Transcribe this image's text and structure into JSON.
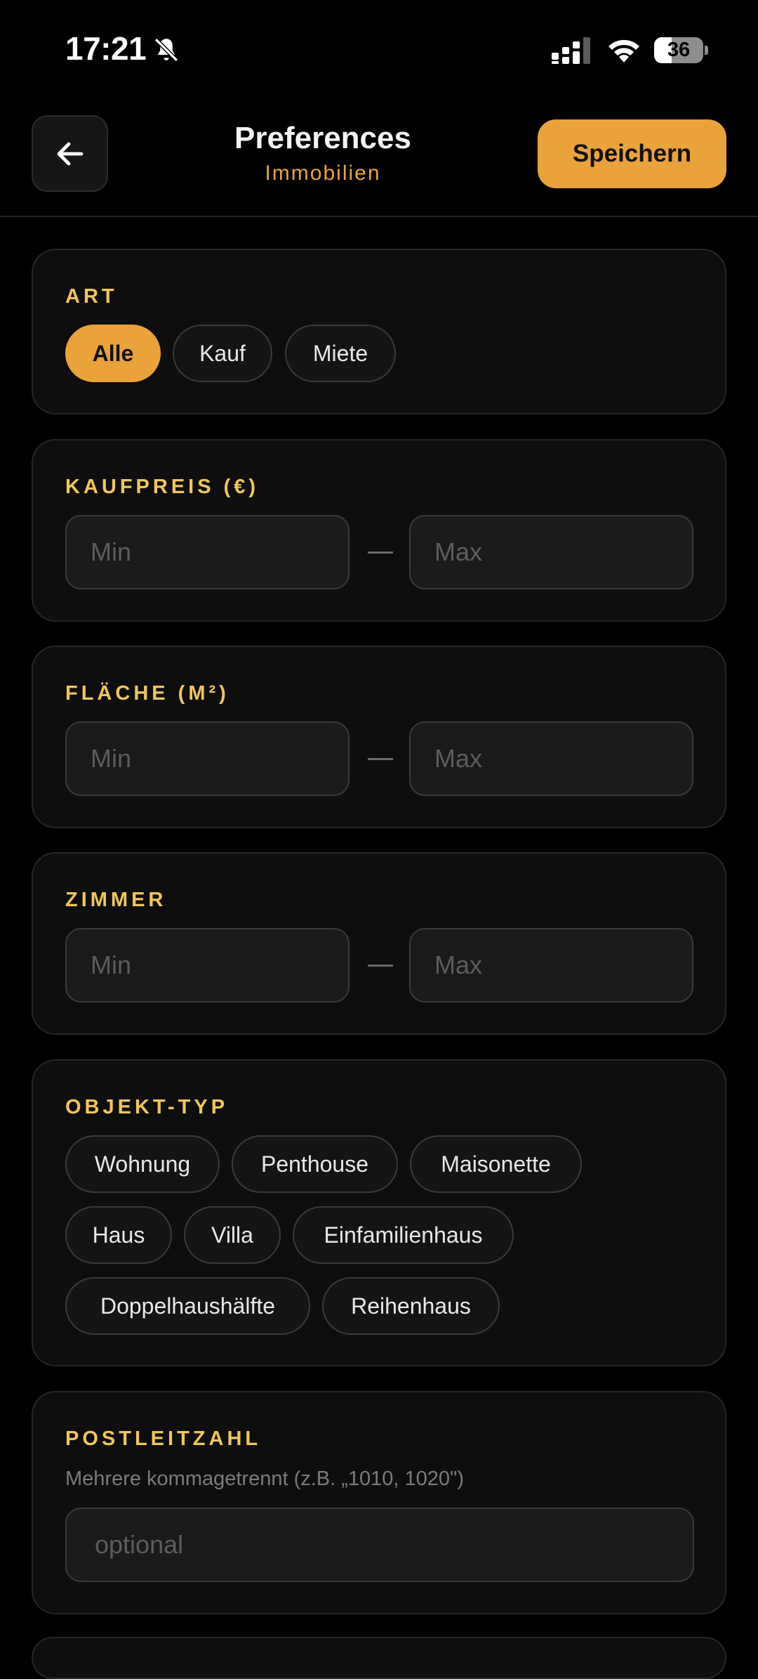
{
  "status_bar": {
    "time": "17:21",
    "battery_level": "36",
    "battery_fraction": 0.36
  },
  "header": {
    "title": "Preferences",
    "subtitle": "Immobilien",
    "save_label": "Speichern"
  },
  "art": {
    "label": "ART",
    "options": [
      "Alle",
      "Kauf",
      "Miete"
    ],
    "selected": "Alle"
  },
  "kaufpreis": {
    "label": "KAUFPREIS (€)",
    "min_placeholder": "Min",
    "max_placeholder": "Max",
    "min_value": "",
    "max_value": ""
  },
  "flaeche": {
    "label": "FLÄCHE (M²)",
    "min_placeholder": "Min",
    "max_placeholder": "Max",
    "min_value": "",
    "max_value": ""
  },
  "zimmer": {
    "label": "ZIMMER",
    "min_placeholder": "Min",
    "max_placeholder": "Max",
    "min_value": "",
    "max_value": ""
  },
  "objekt_typ": {
    "label": "OBJEKT-TYP",
    "options": [
      "Wohnung",
      "Penthouse",
      "Maisonette",
      "Haus",
      "Villa",
      "Einfamilienhaus",
      "Doppelhaushälfte",
      "Reihenhaus"
    ]
  },
  "postleitzahl": {
    "label": "POSTLEITZAHL",
    "hint": "Mehrere kommagetrennt (z.B. „1010, 1020\")",
    "placeholder": "optional",
    "value": ""
  },
  "colors": {
    "accent": "#eaa23a",
    "label": "#f2c55c",
    "background": "#000000",
    "card": "#0e0e0f"
  },
  "icons": {
    "back": "arrow-left-icon",
    "silent": "bell-slash-icon",
    "signal": "signal-icon",
    "wifi": "wifi-icon",
    "battery": "battery-icon"
  }
}
